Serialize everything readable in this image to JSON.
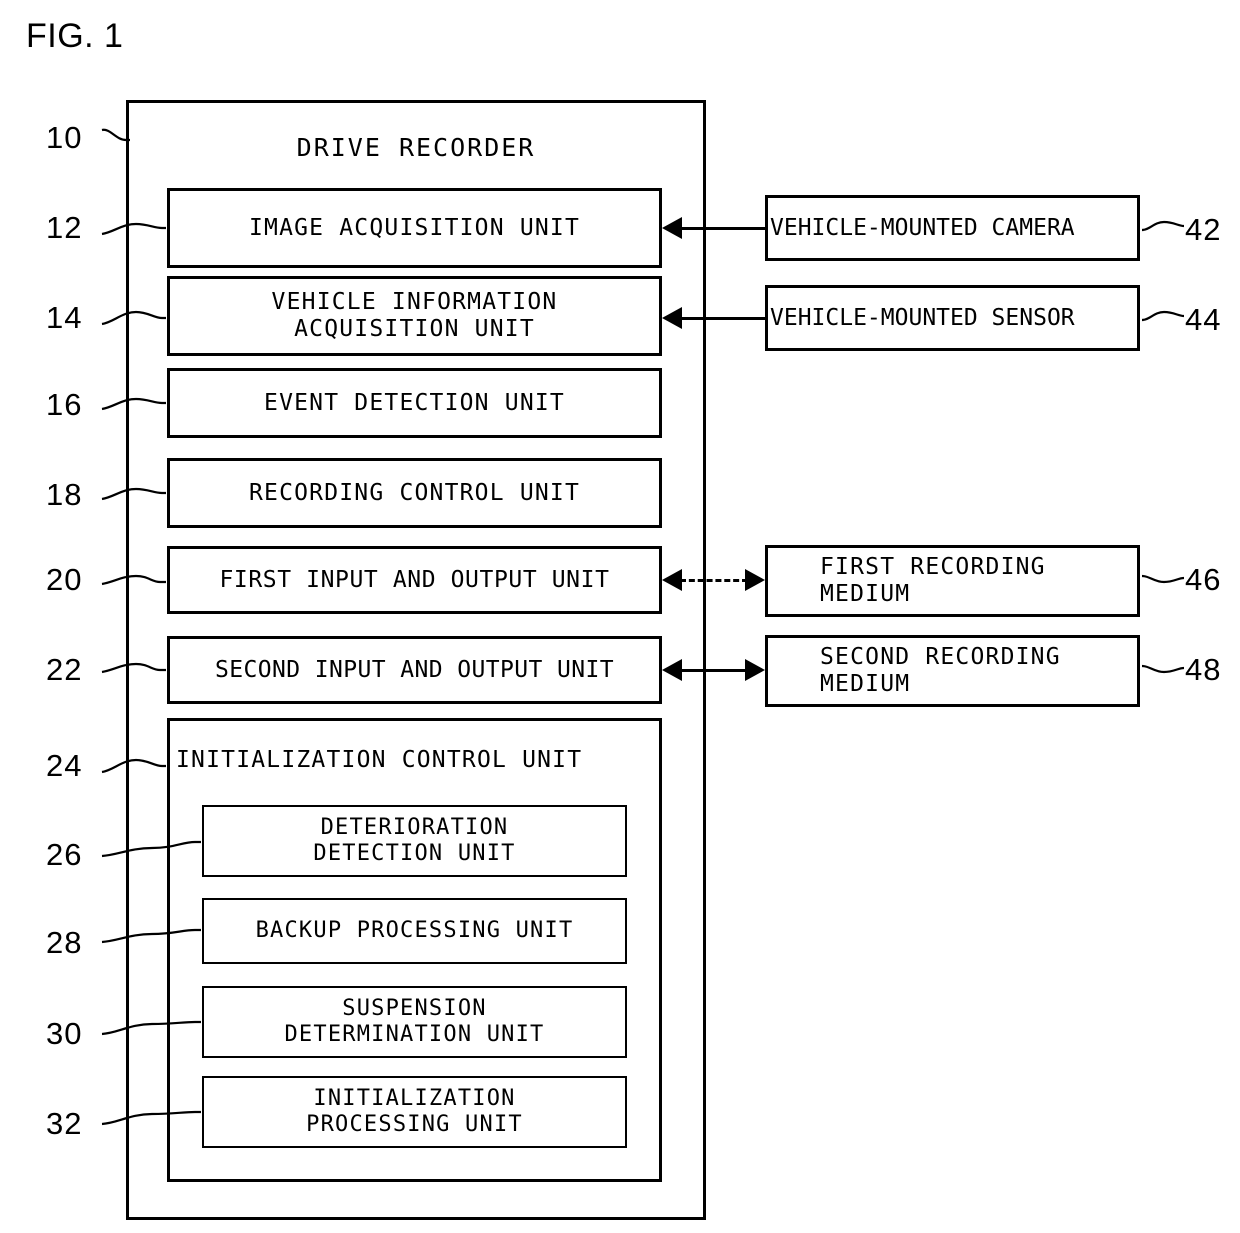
{
  "figure": {
    "label": "FIG. 1",
    "title": "DRIVE RECORDER",
    "title_ref": "10"
  },
  "drive_recorder": {
    "label": "DRIVE RECORDER",
    "ref": "10",
    "units": [
      {
        "ref": "12",
        "label": "IMAGE ACQUISITION UNIT"
      },
      {
        "ref": "14",
        "label": "VEHICLE INFORMATION\nACQUISITION UNIT"
      },
      {
        "ref": "16",
        "label": "EVENT DETECTION UNIT"
      },
      {
        "ref": "18",
        "label": "RECORDING CONTROL UNIT"
      },
      {
        "ref": "20",
        "label": "FIRST INPUT AND OUTPUT UNIT"
      },
      {
        "ref": "22",
        "label": "SECOND INPUT AND OUTPUT UNIT"
      }
    ],
    "initialization_control_unit": {
      "ref": "24",
      "label": "INITIALIZATION CONTROL UNIT",
      "sub_units": [
        {
          "ref": "26",
          "label": "DETERIORATION\nDETECTION UNIT"
        },
        {
          "ref": "28",
          "label": "BACKUP PROCESSING UNIT"
        },
        {
          "ref": "30",
          "label": "SUSPENSION\nDETERMINATION UNIT"
        },
        {
          "ref": "32",
          "label": "INITIALIZATION\nPROCESSING UNIT"
        }
      ]
    }
  },
  "external_devices": [
    {
      "ref": "42",
      "label": "VEHICLE-MOUNTED CAMERA",
      "align": "left"
    },
    {
      "ref": "44",
      "label": "VEHICLE-MOUNTED SENSOR",
      "align": "left"
    },
    {
      "ref": "46",
      "label": "FIRST RECORDING\nMEDIUM",
      "align": "left"
    },
    {
      "ref": "48",
      "label": "SECOND RECORDING\nMEDIUM",
      "align": "left"
    }
  ],
  "connections": [
    {
      "from": "42",
      "to": "12",
      "style": "solid",
      "direction": "left"
    },
    {
      "from": "44",
      "to": "14",
      "style": "solid",
      "direction": "left"
    },
    {
      "from": "46",
      "to": "20",
      "style": "dashed",
      "direction": "both"
    },
    {
      "from": "48",
      "to": "22",
      "style": "solid",
      "direction": "both"
    }
  ],
  "colors": {
    "line": "#000000",
    "background": "#ffffff",
    "text": "#000000"
  }
}
